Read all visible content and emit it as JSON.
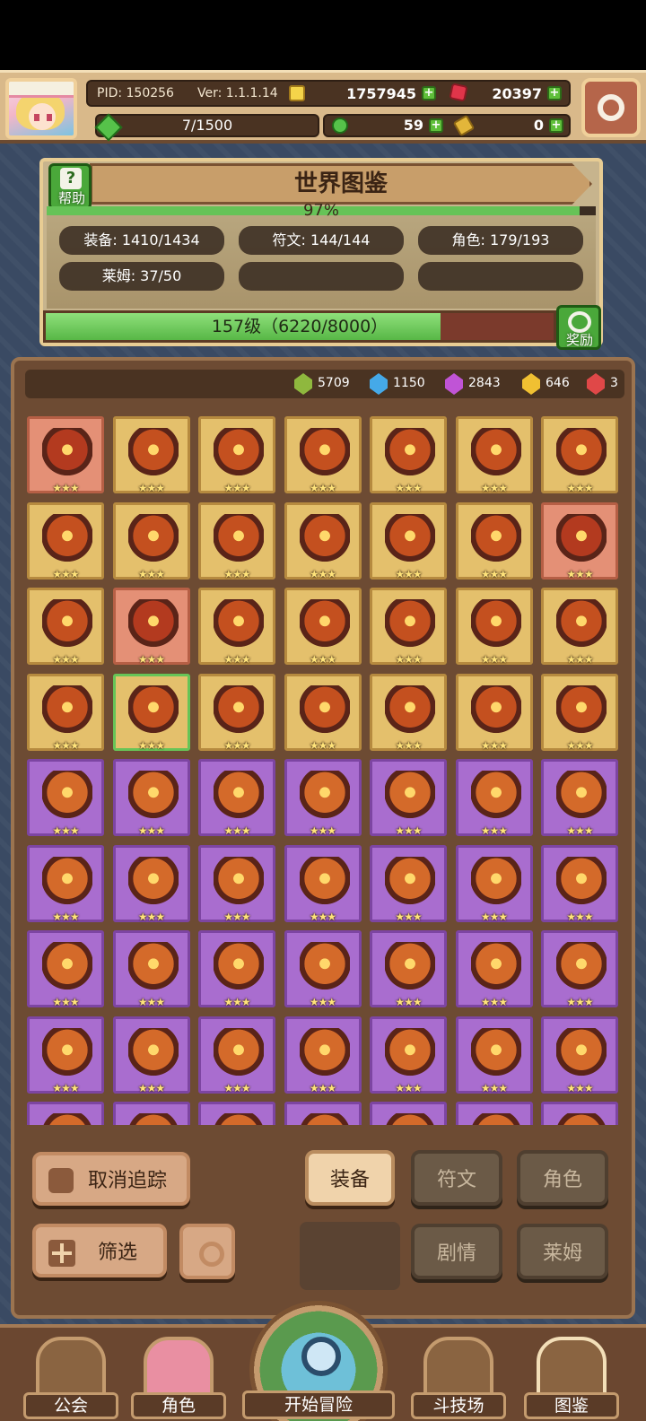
{
  "header": {
    "pid": "PID: 150256",
    "version": "Ver: 1.1.1.14",
    "gold": "1757945",
    "gems": "20397",
    "stamina": "7/1500",
    "clover": "59",
    "key": "0"
  },
  "atlas": {
    "title": "世界图鉴",
    "help_label": "帮助",
    "percent": "97%",
    "percent_value": 0.97,
    "stats": {
      "equipment": "装备: 1410/1434",
      "runes": "符文: 144/144",
      "characters": "角色: 179/193",
      "slimes": "莱姆: 37/50"
    },
    "level_text": "157级（6220/8000）",
    "level_progress": 0.7775,
    "reward_label": "奖励"
  },
  "essences": [
    {
      "count": "5709",
      "color": "#8fb83e"
    },
    {
      "count": "1150",
      "color": "#45a9e8"
    },
    {
      "count": "2843",
      "color": "#c054d6"
    },
    {
      "count": "646",
      "color": "#f0c032"
    },
    {
      "count": "3",
      "color": "#e04848"
    }
  ],
  "items": {
    "rows": [
      [
        "red",
        "gold",
        "gold",
        "gold",
        "gold",
        "gold",
        "gold"
      ],
      [
        "gold",
        "gold",
        "gold",
        "gold",
        "gold",
        "gold",
        "red"
      ],
      [
        "gold",
        "red",
        "gold",
        "gold",
        "gold",
        "gold",
        "gold"
      ],
      [
        "gold",
        "selgreen",
        "gold",
        "gold",
        "gold",
        "gold",
        "gold"
      ],
      [
        "purple",
        "purple",
        "purple",
        "purple",
        "purple",
        "purple",
        "purple"
      ],
      [
        "purple",
        "purple",
        "purple",
        "purple",
        "purple",
        "purple",
        "purple"
      ],
      [
        "purple",
        "purple",
        "purple",
        "purple",
        "purple",
        "purple",
        "purple"
      ],
      [
        "purple",
        "purple",
        "purple",
        "purple",
        "purple",
        "purple",
        "purple"
      ],
      [
        "purple",
        "purple",
        "purple",
        "purple",
        "purple",
        "purple",
        "purple"
      ]
    ],
    "star_text": "★★★"
  },
  "controls": {
    "untrack": "取消追踪",
    "filter": "筛选",
    "tab_equipment": "装备",
    "tab_runes": "符文",
    "tab_characters": "角色",
    "tab_story": "剧情",
    "tab_slimes": "莱姆"
  },
  "nav": {
    "guild": "公会",
    "character": "角色",
    "adventure": "开始冒险",
    "arena": "斗技场",
    "atlas": "图鉴"
  },
  "colors": {
    "progress_green": "#57b746",
    "panel_brown": "#6d4b33",
    "gold_cell": "#e4c06c",
    "purple_cell": "#a96dcf",
    "red_cell": "#e49076"
  }
}
